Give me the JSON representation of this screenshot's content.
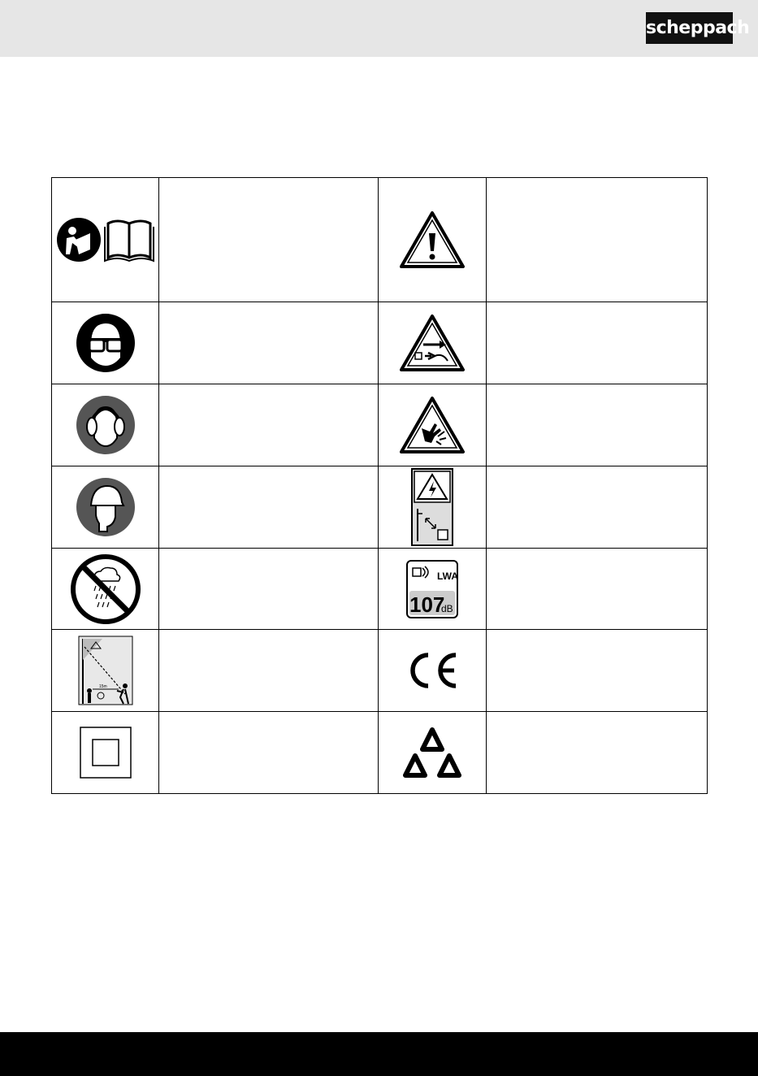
{
  "header": {
    "brand_logo": "scheppach",
    "brand_color": "#111111",
    "bar_color": "#e6e6e6"
  },
  "symbols": {
    "rows": [
      {
        "left": {
          "icon": "read-manual-icon",
          "text": ""
        },
        "right": {
          "icon": "warning-triangle-icon",
          "text": ""
        }
      },
      {
        "left": {
          "icon": "eye-protection-icon",
          "text": ""
        },
        "right": {
          "icon": "unplug-power-icon",
          "text": ""
        }
      },
      {
        "left": {
          "icon": "ear-protection-icon",
          "text": ""
        },
        "right": {
          "icon": "cut-hazard-icon",
          "text": ""
        }
      },
      {
        "left": {
          "icon": "head-protection-icon",
          "text": ""
        },
        "right": {
          "icon": "power-line-distance-icon",
          "text": ""
        }
      },
      {
        "left": {
          "icon": "no-rain-icon",
          "text": ""
        },
        "right": {
          "icon": "sound-power-level-icon",
          "text": "",
          "value": "107",
          "unit": "dB",
          "label": "LWA"
        }
      },
      {
        "left": {
          "icon": "safety-distance-icon",
          "text": "",
          "values": [
            "15m"
          ]
        },
        "right": {
          "icon": "ce-mark-icon",
          "text": ""
        }
      },
      {
        "left": {
          "icon": "protection-class-ii-icon",
          "text": ""
        },
        "right": {
          "icon": "three-triangles-icon",
          "text": ""
        }
      }
    ]
  }
}
